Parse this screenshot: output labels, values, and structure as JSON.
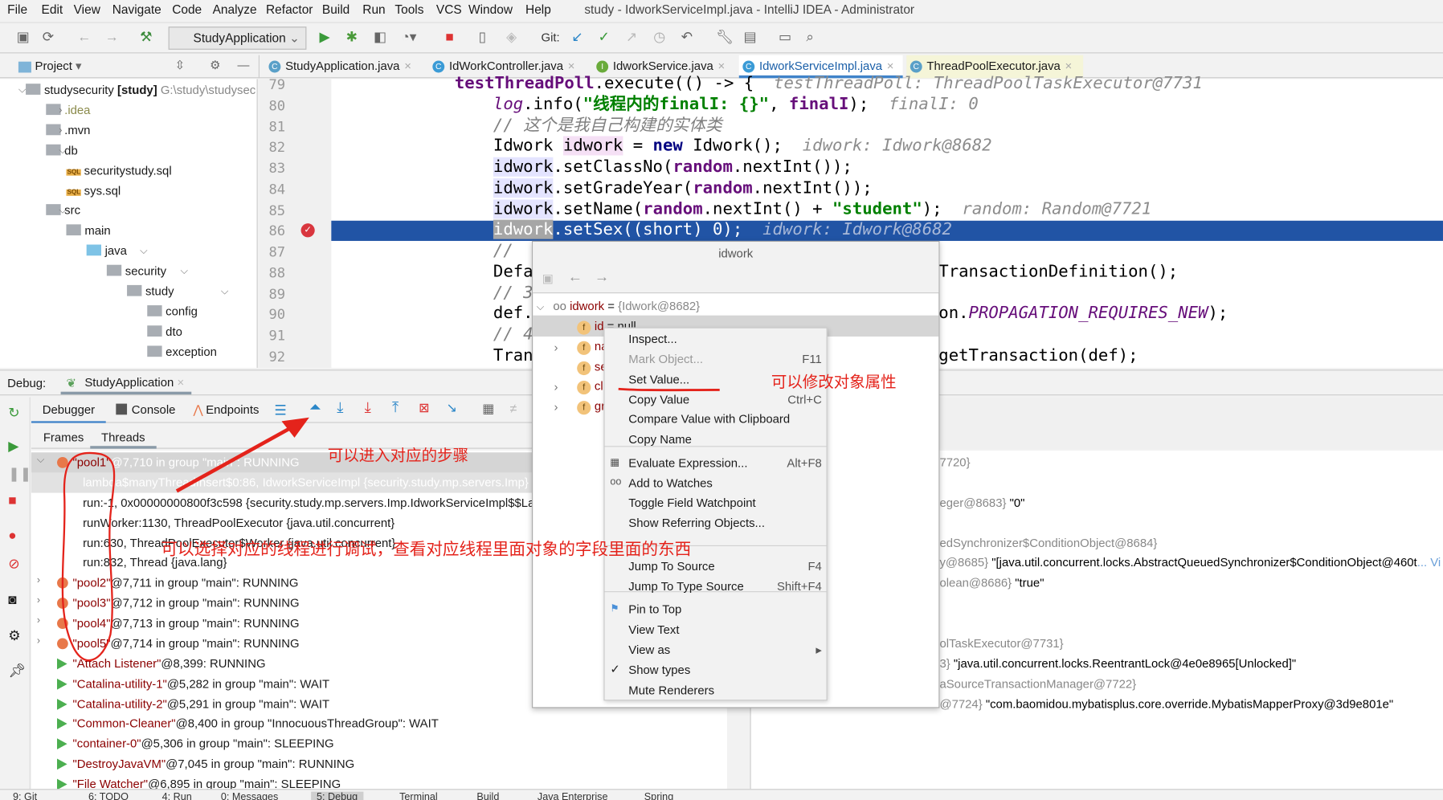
{
  "menu": [
    "File",
    "Edit",
    "View",
    "Navigate",
    "Code",
    "Analyze",
    "Refactor",
    "Build",
    "Run",
    "Tools",
    "VCS",
    "Window",
    "Help"
  ],
  "window_title": "study - IdworkServiceImpl.java - IntelliJ IDEA - Administrator",
  "toolbar": {
    "run_config": "StudyApplication",
    "git_label": "Git:"
  },
  "project_panel": {
    "title": "Project",
    "tree": [
      {
        "label": "studysecurity",
        "bold": "[study]",
        "path": "G:\\study\\studysec"
      },
      {
        "label": ".idea"
      },
      {
        "label": ".mvn"
      },
      {
        "label": "db"
      },
      {
        "label": "securitystudy.sql"
      },
      {
        "label": "sys.sql"
      },
      {
        "label": "src"
      },
      {
        "label": "main"
      },
      {
        "label": "java"
      },
      {
        "label": "security"
      },
      {
        "label": "study"
      },
      {
        "label": "config"
      },
      {
        "label": "dto"
      },
      {
        "label": "exception"
      }
    ]
  },
  "editor_tabs": [
    {
      "label": "StudyApplication.java",
      "icon": "C",
      "color": "#5aa0c8"
    },
    {
      "label": "IdWorkController.java",
      "icon": "C",
      "color": "#3b9bd6"
    },
    {
      "label": "IdworkService.java",
      "icon": "I",
      "color": "#6aab3b"
    },
    {
      "label": "IdworkServiceImpl.java",
      "icon": "C",
      "color": "#3b9bd6",
      "active": true
    },
    {
      "label": "ThreadPoolExecutor.java",
      "icon": "C",
      "color": "#5aa0c8",
      "readonly": true
    }
  ],
  "editor": {
    "line_numbers": [
      "79",
      "80",
      "81",
      "82",
      "83",
      "84",
      "85",
      "86",
      "87",
      "88",
      "89",
      "90",
      "91",
      "92"
    ],
    "current_line": "86",
    "lines": [
      [
        {
          "t": "testThreadPoll",
          "c": "fld"
        },
        {
          "t": ".execute(() -> {  "
        },
        {
          "t": "testThreadPoll: ThreadPoolTaskExecutor@7731",
          "c": "hint"
        }
      ],
      [
        {
          "t": "log",
          "c": "it"
        },
        {
          "t": ".info("
        },
        {
          "t": "\"线程内的finalI: {}\"",
          "c": "str"
        },
        {
          "t": ", "
        },
        {
          "t": "finalI",
          "c": "fld"
        },
        {
          "t": ");  "
        },
        {
          "t": "finalI: 0",
          "c": "hint"
        }
      ],
      [
        {
          "t": "// 这个是我自己构建的实体类",
          "c": "cm"
        }
      ],
      [
        {
          "t": "Idwork "
        },
        {
          "t": "idwork",
          "c": "hl1"
        },
        {
          "t": " = "
        },
        {
          "t": "new",
          "c": "kw"
        },
        {
          "t": " Idwork();  "
        },
        {
          "t": "idwork: Idwork@8682",
          "c": "hint"
        }
      ],
      [
        {
          "t": "idwork",
          "c": "hl2"
        },
        {
          "t": ".setClassNo("
        },
        {
          "t": "random",
          "c": "fld"
        },
        {
          "t": ".nextInt());"
        }
      ],
      [
        {
          "t": "idwork",
          "c": "hl2"
        },
        {
          "t": ".setGradeYear("
        },
        {
          "t": "random",
          "c": "fld"
        },
        {
          "t": ".nextInt());"
        }
      ],
      [
        {
          "t": "idwork",
          "c": "hl2"
        },
        {
          "t": ".setName("
        },
        {
          "t": "random",
          "c": "fld"
        },
        {
          "t": ".nextInt() + "
        },
        {
          "t": "\"student\"",
          "c": "str"
        },
        {
          "t": ");  "
        },
        {
          "t": "random: Random@7721",
          "c": "hint"
        }
      ],
      [
        {
          "t": "idwork",
          "c": "sel"
        },
        {
          "t": ".setSex((short) 0);  "
        },
        {
          "t": "idwork: Idwork@8682",
          "c": "hint"
        }
      ],
      [
        {
          "t": "// ",
          "c": "cm"
        }
      ],
      [
        {
          "t": "Defa"
        }
      ],
      [
        {
          "t": "// 3",
          "c": "cm"
        }
      ],
      [
        {
          "t": "def."
        }
      ],
      [
        {
          "t": "// 4",
          "c": "cm"
        }
      ],
      [
        {
          "t": "Tran"
        }
      ]
    ],
    "right_fragments": {
      "88": "TransactionDefinition();",
      "90a": "on.",
      "90b": "PROPAGATION_REQUIRES_NEW",
      "90c": ");",
      "92": "getTransaction(def);"
    }
  },
  "debug": {
    "label": "Debug:",
    "session": "StudyApplication",
    "tabs": [
      "Debugger",
      "Console",
      "Endpoints"
    ],
    "subtabs": [
      "Frames",
      "Threads"
    ],
    "threads": [
      {
        "q": "\"pool1\"",
        "rest": "@7,710 in group \"main\": RUNNING",
        "kind": "pool",
        "expanded": true,
        "selected": true
      },
      {
        "frame": "lambda$manyThreadInsert$0:86, IdworkServiceImpl {security.study.mp.servers.Imp}",
        "selected": true
      },
      {
        "frame": "run:-1, 0x00000000800f3c598 {security.study.mp.servers.Imp.IdworkServiceImpl$$Lam"
      },
      {
        "frame": "runWorker:1130, ThreadPoolExecutor {java.util.concurrent}"
      },
      {
        "frame": "run:630, ThreadPoolExecutor$Worker {java.util.concurrent}"
      },
      {
        "frame": "run:832, Thread {java.lang}"
      },
      {
        "q": "\"pool2\"",
        "rest": "@7,711 in group \"main\": RUNNING",
        "kind": "pool"
      },
      {
        "q": "\"pool3\"",
        "rest": "@7,712 in group \"main\": RUNNING",
        "kind": "pool"
      },
      {
        "q": "\"pool4\"",
        "rest": "@7,713 in group \"main\": RUNNING",
        "kind": "pool"
      },
      {
        "q": "\"pool5\"",
        "rest": "@7,714 in group \"main\": RUNNING",
        "kind": "pool"
      },
      {
        "q": "\"Attach Listener\"",
        "rest": "@8,399: RUNNING",
        "kind": "run"
      },
      {
        "q": "\"Catalina-utility-1\"",
        "rest": "@5,282 in group \"main\": WAIT",
        "kind": "run"
      },
      {
        "q": "\"Catalina-utility-2\"",
        "rest": "@5,291 in group \"main\": WAIT",
        "kind": "run"
      },
      {
        "q": "\"Common-Cleaner\"",
        "rest": "@8,400 in group \"InnocuousThreadGroup\": WAIT",
        "kind": "run"
      },
      {
        "q": "\"container-0\"",
        "rest": "@5,306 in group \"main\": SLEEPING",
        "kind": "run"
      },
      {
        "q": "\"DestroyJavaVM\"",
        "rest": "@7,045 in group \"main\": RUNNING",
        "kind": "run"
      },
      {
        "q": "\"File Watcher\"",
        "rest": "@6,895 in group \"main\": SLEEPING",
        "kind": "run"
      }
    ],
    "variables": [
      {
        "row": 0,
        "g": "7720}",
        "v": ""
      },
      {
        "row": 2,
        "g": "eger@8683}",
        "v": " \"0\""
      },
      {
        "row": 4,
        "g": "edSynchronizer$ConditionObject@8684}",
        "v": ""
      },
      {
        "row": 5,
        "g": "y@8685}",
        "v": " \"[java.util.concurrent.locks.AbstractQueuedSynchronizer$ConditionObject@460t",
        "more": "... Vi"
      },
      {
        "row": 6,
        "g": "olean@8686}",
        "v": " \"true\""
      },
      {
        "row": 9,
        "g": "olTaskExecutor@7731}",
        "v": ""
      },
      {
        "row": 10,
        "g": "3}",
        "v": " \"java.util.concurrent.locks.ReentrantLock@4e0e8965[Unlocked]\""
      },
      {
        "row": 11,
        "g": "aSourceTransactionManager@7722}",
        "v": ""
      },
      {
        "row": 12,
        "g": "@7724}",
        "v": " \"com.baomidou.mybatisplus.core.override.MybatisMapperProxy@3d9e801e\""
      }
    ]
  },
  "popup": {
    "title": "idwork",
    "root_name": "idwork",
    "root_value": "{Idwork@8682}",
    "fields": [
      {
        "name": "id",
        "value": "= null"
      },
      {
        "name": "na"
      },
      {
        "name": "se"
      },
      {
        "name": "cl"
      },
      {
        "name": "gr"
      }
    ]
  },
  "context_menu": {
    "items": [
      {
        "label": "Inspect..."
      },
      {
        "label": "Mark Object...",
        "shortcut": "F11",
        "disabled": true
      },
      {
        "label": "Set Value..."
      },
      {
        "label": "Copy Value",
        "shortcut": "Ctrl+C"
      },
      {
        "label": "Compare Value with Clipboard"
      },
      {
        "label": "Copy Name"
      },
      {
        "label": "Evaluate Expression...",
        "shortcut": "Alt+F8"
      },
      {
        "label": "Add to Watches"
      },
      {
        "label": "Toggle Field Watchpoint"
      },
      {
        "label": "Show Referring Objects..."
      },
      {
        "label": "Jump To Source",
        "shortcut": "F4"
      },
      {
        "label": "Jump To Type Source",
        "shortcut": "Shift+F4"
      },
      {
        "label": "Pin to Top"
      },
      {
        "label": "View Text"
      },
      {
        "label": "View as",
        "submenu": true
      },
      {
        "label": "Show types",
        "checked": true
      },
      {
        "label": "Mute Renderers"
      }
    ]
  },
  "annotations": {
    "steps": "可以进入对应的步骤",
    "threads": "可以选择对应的线程进行调试，查看对应线程里面对象的字段里面的东西",
    "set_value": "可以修改对象属性",
    "color": "#e4231b"
  },
  "bottom_bar": [
    "9: Git",
    "6: TODO",
    "4: Run",
    "0: Messages",
    "5: Debug",
    "Terminal",
    "Build",
    "Java Enterprise",
    "Spring"
  ]
}
